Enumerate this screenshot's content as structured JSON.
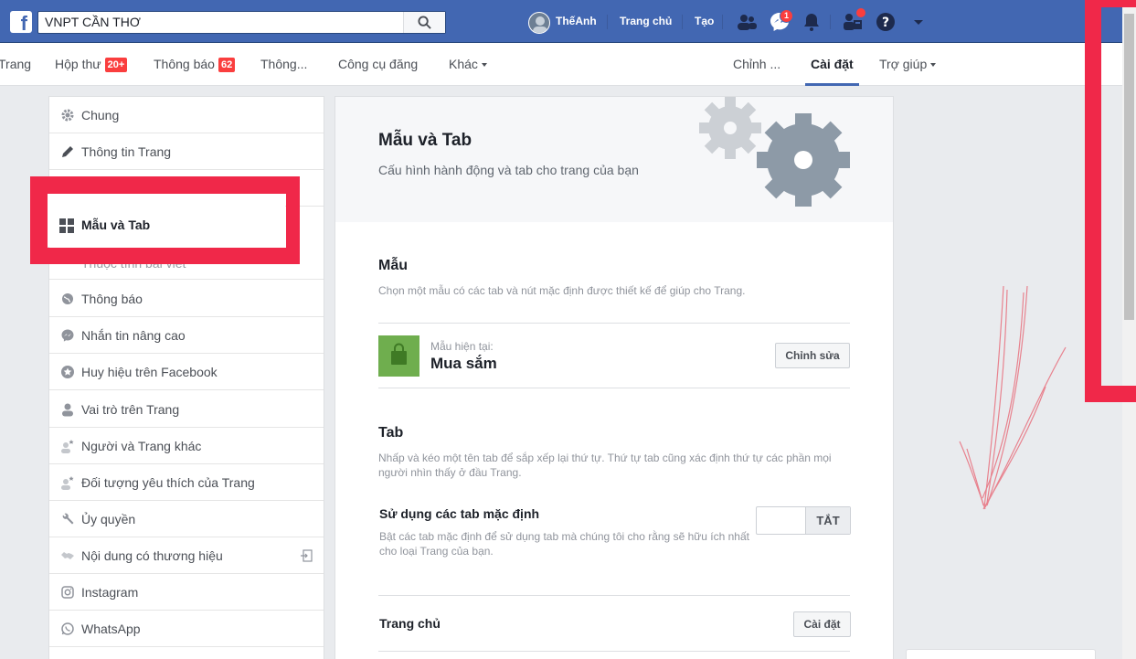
{
  "topbar": {
    "search_value": "VNPT CẦN THƠ",
    "user_name": "ThếAnh",
    "home_label": "Trang chủ",
    "create_label": "Tạo",
    "messenger_badge": "1",
    "brand_color": "#4267b2"
  },
  "pagenav": {
    "page_label": "Trang",
    "inbox_label": "Hộp thư",
    "inbox_badge": "20+",
    "notifications_label": "Thông báo",
    "notifications_badge": "62",
    "insights_label": "Thông...",
    "publishing_tools_label": "Công cụ đăng",
    "more_label": "Khác",
    "edit_page_label": "Chỉnh ...",
    "settings_label": "Cài đặt",
    "help_label": "Trợ giúp"
  },
  "sidebar": {
    "items": [
      {
        "label": "Chung",
        "icon": "gear-icon"
      },
      {
        "label": "Thông tin Trang",
        "icon": "pencil-icon"
      },
      {
        "label": "",
        "icon": ""
      },
      {
        "label": "Mẫu và Tab",
        "icon": "grid-icon"
      },
      {
        "label": "",
        "icon": "flag-icon"
      },
      {
        "label": "Thông báo",
        "icon": "globe-icon"
      },
      {
        "label": "Nhắn tin nâng cao",
        "icon": "messenger-icon"
      },
      {
        "label": "Huy hiệu trên Facebook",
        "icon": "star-badge-icon"
      },
      {
        "label": "Vai trò trên Trang",
        "icon": "person-icon"
      },
      {
        "label": "Người và Trang khác",
        "icon": "people-star-icon"
      },
      {
        "label": "Đối tượng yêu thích của Trang",
        "icon": "people-star-icon"
      },
      {
        "label": "Ủy quyền",
        "icon": "wrench-icon"
      },
      {
        "label": "Nội dung có thương hiệu",
        "icon": "handshake-icon"
      },
      {
        "label": "Instagram",
        "icon": "instagram-icon"
      },
      {
        "label": "WhatsApp",
        "icon": "whatsapp-icon"
      }
    ],
    "partial_text": "Thuộc tính bài viết"
  },
  "main": {
    "title": "Mẫu và Tab",
    "subtitle": "Cấu hình hành động và tab cho trang của bạn",
    "template_section": {
      "title": "Mẫu",
      "description": "Chọn một mẫu có các tab và nút mặc định được thiết kế để giúp cho Trang.",
      "current_label": "Mẫu hiện tại:",
      "current_value": "Mua sắm",
      "edit_button": "Chỉnh sửa"
    },
    "tabs_section": {
      "title": "Tab",
      "description_line1": "Nhấp và kéo một tên tab để sắp xếp lại thứ tự. Thứ tự tab cũng xác định thứ tự các phần mọi",
      "description_line2": "người nhìn thấy ở đầu Trang.",
      "default_tabs_label": "Sử dụng các tab mặc định",
      "default_tabs_desc_line1": "Bật các tab mặc định để sử dụng tab mà chúng tôi cho rằng sẽ hữu ích nhất",
      "default_tabs_desc_line2": "cho loại Trang của bạn.",
      "toggle_state": "TẮT",
      "home_tab_label": "Trang chủ",
      "home_tab_button": "Cài đặt"
    }
  },
  "annotations": {
    "highlight_color": "#f02849"
  }
}
